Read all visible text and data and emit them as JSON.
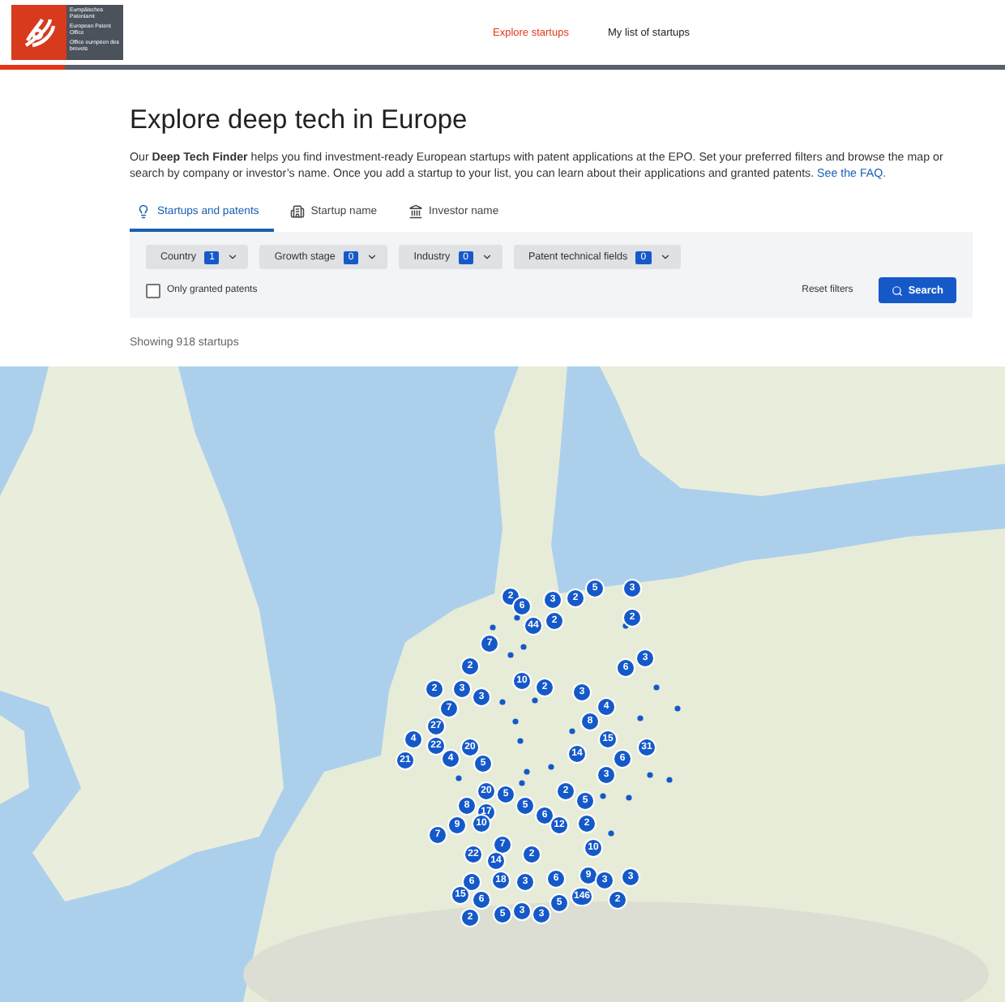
{
  "header": {
    "logo_text": [
      "Europäisches Patentamt",
      "European Patent Office",
      "Office européen des brevets"
    ],
    "nav": [
      {
        "label": "Explore startups",
        "selected": true
      },
      {
        "label": "My list of startups",
        "selected": false
      }
    ]
  },
  "title": "Explore deep tech in Europe",
  "intro": {
    "text": "Our **Deep Tech Finder** helps you find investment-ready European startups with patent applications at the EPO. Set your preferred filters and browse the map or search by company or investor’s name. Once you add a startup to your list, you can learn about their applications and granted patents.",
    "link": "See the FAQ."
  },
  "tabs": [
    {
      "label": "Startups and patents",
      "kind": "bulb",
      "selected": true
    },
    {
      "label": "Startup name",
      "kind": "building",
      "selected": false
    },
    {
      "label": "Investor name",
      "kind": "bank",
      "selected": false
    }
  ],
  "filters": [
    {
      "label": "Country",
      "count": "1"
    },
    {
      "label": "Growth stage",
      "count": "0"
    },
    {
      "label": "Industry",
      "count": "0"
    },
    {
      "label": "Patent technical fields",
      "count": "0"
    }
  ],
  "granted_only": {
    "label": "Only granted patents",
    "checked": false
  },
  "reset_label": "Reset filters",
  "search_label": "Search",
  "result_count": "Showing 918 startups",
  "map": {
    "markers": [
      "2",
      "6",
      "3",
      "2",
      "5",
      "3",
      "44",
      "2",
      "2",
      "7",
      "2",
      "6",
      "3",
      "2",
      "3",
      "3",
      "10",
      "2",
      "3",
      "7",
      "4",
      "27",
      "8",
      "4",
      "22",
      "20",
      "15",
      "31",
      "21",
      "4",
      "5",
      "14",
      "6",
      "3",
      "20",
      "5",
      "2",
      "8",
      "17",
      "5",
      "6",
      "5",
      "9",
      "10",
      "12",
      "2",
      "7",
      "22",
      "7",
      "2",
      "10",
      "14",
      "6",
      "18",
      "3",
      "6",
      "9",
      "3",
      "3",
      "15",
      "6",
      "5",
      "146",
      "2",
      "2",
      "5",
      "3",
      "3"
    ]
  }
}
